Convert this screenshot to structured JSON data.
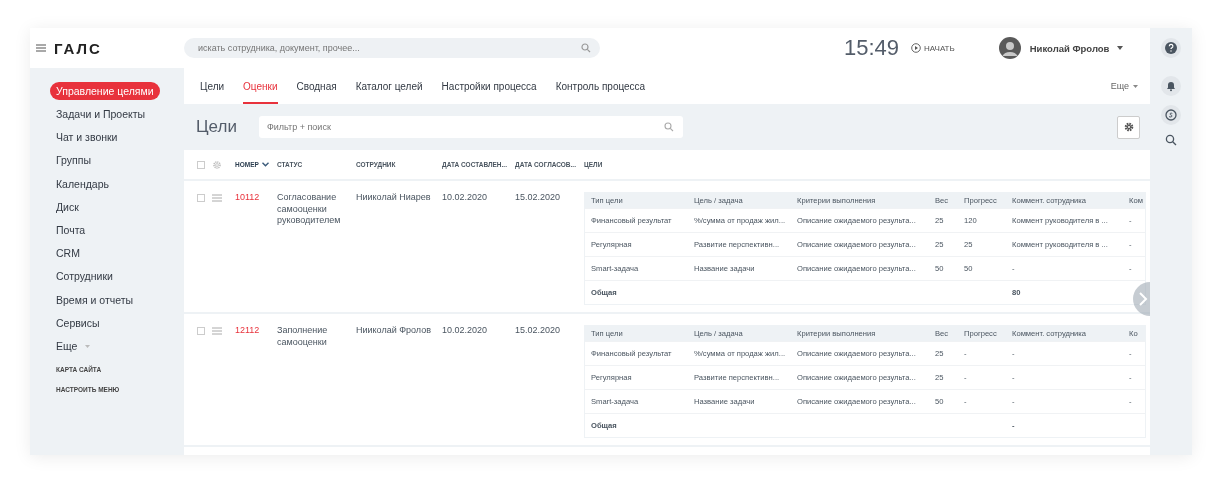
{
  "header": {
    "logo": "ГАЛС",
    "search": {
      "placeholder": "искать сотрудника, документ, прочее..."
    },
    "clock": "15:49",
    "start": "НАЧАТЬ",
    "user": "Николай Фролов"
  },
  "sidebar": {
    "items": [
      {
        "label": "Управление целями",
        "selected": true
      },
      {
        "label": "Задачи и Проекты",
        "selected": false
      },
      {
        "label": "Чат и звонки",
        "selected": false
      },
      {
        "label": "Группы",
        "selected": false
      },
      {
        "label": "Календарь",
        "selected": false
      },
      {
        "label": "Диск",
        "selected": false
      },
      {
        "label": "Почта",
        "selected": false
      },
      {
        "label": "CRM",
        "selected": false
      },
      {
        "label": "Сотрудники",
        "selected": false
      },
      {
        "label": "Время и отчеты",
        "selected": false
      },
      {
        "label": "Сервисы",
        "selected": false
      }
    ],
    "more": "Еще",
    "links": [
      "КАРТА САЙТА",
      "НАСТРОИТЬ МЕНЮ"
    ]
  },
  "tabs": [
    {
      "label": "Цели",
      "selected": false
    },
    {
      "label": "Оценки",
      "selected": true
    },
    {
      "label": "Сводная",
      "selected": false
    },
    {
      "label": "Каталог целей",
      "selected": false
    },
    {
      "label": "Настройки процесса",
      "selected": false
    },
    {
      "label": "Контроль процесса",
      "selected": false
    }
  ],
  "tabs_more": "Еще",
  "page_title": "Цели",
  "filter": {
    "placeholder": "Фильтр + поиск"
  },
  "table": {
    "select_all": {
      "checked": false
    },
    "columns": [
      {
        "label": "НОМЕР",
        "sorted": true
      },
      {
        "label": "СТАТУС",
        "sorted": false
      },
      {
        "label": "СОТРУДНИК",
        "sorted": false
      },
      {
        "label": "ДАТА СОСТАВЛЕН...",
        "sorted": false
      },
      {
        "label": "ДАТА СОГЛАСОВ...",
        "sorted": false
      },
      {
        "label": "ЦЕЛИ",
        "sorted": false
      }
    ],
    "rows": [
      {
        "checked": false,
        "number": "10112",
        "status": "Согласование самооценки руководителем",
        "employee": "Нииколай Ниарев",
        "date_created": "10.02.2020",
        "date_agreed": "15.02.2020",
        "goals": {
          "columns": [
            "Тип цели",
            "Цель / задача",
            "Критерии выполнения",
            "Вес",
            "Прогресс",
            "Коммент. сотрудника",
            "Ком"
          ],
          "rows": [
            [
              "Финансовый результат",
              "%/сумма от продаж жил...",
              "Описание ожидаемого результа...",
              "25",
              "120",
              "Коммент руководителя в ...",
              "-"
            ],
            [
              "Регулярная",
              "Развитие перспективн...",
              "Описание ожидаемого результа...",
              "25",
              "25",
              "Коммент руководителя в ...",
              "-"
            ],
            [
              "Smart-задача",
              "Название задачи",
              "Описание ожидаемого результа...",
              "50",
              "50",
              "-",
              "-"
            ]
          ],
          "total": {
            "label": "Общая",
            "sum": "80"
          }
        }
      },
      {
        "checked": false,
        "number": "12112",
        "status": "Заполнение самооценки",
        "employee": "Нииколай Фролов",
        "date_created": "10.02.2020",
        "date_agreed": "15.02.2020",
        "goals": {
          "columns": [
            "Тип цели",
            "Цель / задача",
            "Критерии выполнения",
            "Вес",
            "Прогресс",
            "Коммент. сотрудника",
            "Ко"
          ],
          "rows": [
            [
              "Финансовый результат",
              "%/сумма от продаж жил...",
              "Описание ожидаемого результа...",
              "25",
              "-",
              "-",
              "-"
            ],
            [
              "Регулярная",
              "Развитие перспективн...",
              "Описание ожидаемого результа...",
              "25",
              "-",
              "-",
              "-"
            ],
            [
              "Smart-задача",
              "Название задачи",
              "Описание ожидаемого результа...",
              "50",
              "-",
              "-",
              "-"
            ]
          ],
          "total": {
            "label": "Общая",
            "sum": "-"
          }
        }
      }
    ]
  }
}
